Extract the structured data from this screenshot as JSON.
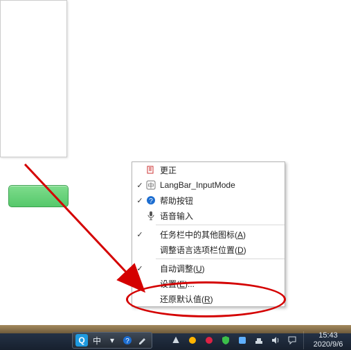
{
  "menu": {
    "items": [
      {
        "checked": false,
        "icon": "correction-icon",
        "label": "更正"
      },
      {
        "checked": true,
        "icon": "cn-ime-icon",
        "label": "LangBar_InputMode"
      },
      {
        "checked": true,
        "icon": "help-icon",
        "label": "帮助按钮"
      },
      {
        "checked": false,
        "icon": "mic-icon",
        "label": "语音输入"
      }
    ],
    "items2": [
      {
        "checked": true,
        "label_pre": "任务栏中的其他图标(",
        "mn": "A",
        "label_post": ")"
      },
      {
        "checked": false,
        "label_pre": "调整语言选项栏位置(",
        "mn": "D",
        "label_post": ")"
      }
    ],
    "items3": [
      {
        "checked": true,
        "label_pre": "自动调整(",
        "mn": "U",
        "label_post": ")"
      },
      {
        "checked": false,
        "label_pre": "设置(",
        "mn": "E",
        "label_post": ")..."
      },
      {
        "checked": false,
        "label_pre": "还原默认值(",
        "mn": "R",
        "label_post": ")"
      }
    ]
  },
  "langbar": {
    "q": "Q",
    "mode": "中",
    "caret": "▾",
    "help": "?"
  },
  "tray": {
    "up": "▲"
  },
  "clock": {
    "time": "15:43",
    "date": "2020/9/6"
  }
}
